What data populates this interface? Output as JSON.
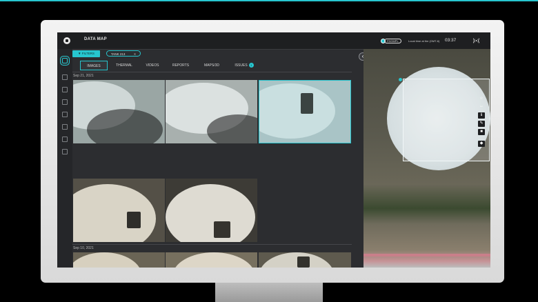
{
  "app": {
    "title": "DATA MAP",
    "badge_text": "FDGMPL",
    "local_time_label": "Local time at the (GMT-6)",
    "clock": "03:37"
  },
  "filter": {
    "button_label": "FILTERS",
    "chip_label": "TANK 213",
    "chip_clear": "X"
  },
  "tabs": [
    {
      "label": "IMAGES",
      "active": true
    },
    {
      "label": "THERMAL",
      "active": false
    },
    {
      "label": "VIDEOS",
      "active": false
    },
    {
      "label": "REPORTS",
      "active": false
    },
    {
      "label": "MAPS/3D",
      "active": false
    },
    {
      "label": "ISSUES",
      "active": false,
      "count": "1"
    }
  ],
  "sections": [
    {
      "date": "Sep 21, 2021",
      "thumb_count": 5
    },
    {
      "date": "Sep 10, 2021",
      "thumb_count": 3
    }
  ],
  "map_tools": [
    "star-icon",
    "expand-icon",
    "info-icon",
    "pencil-icon",
    "trash-icon",
    "layers-icon"
  ],
  "colors": {
    "accent": "#27c6cf",
    "panel": "#2c2d30",
    "topbar": "#1e1f21"
  }
}
